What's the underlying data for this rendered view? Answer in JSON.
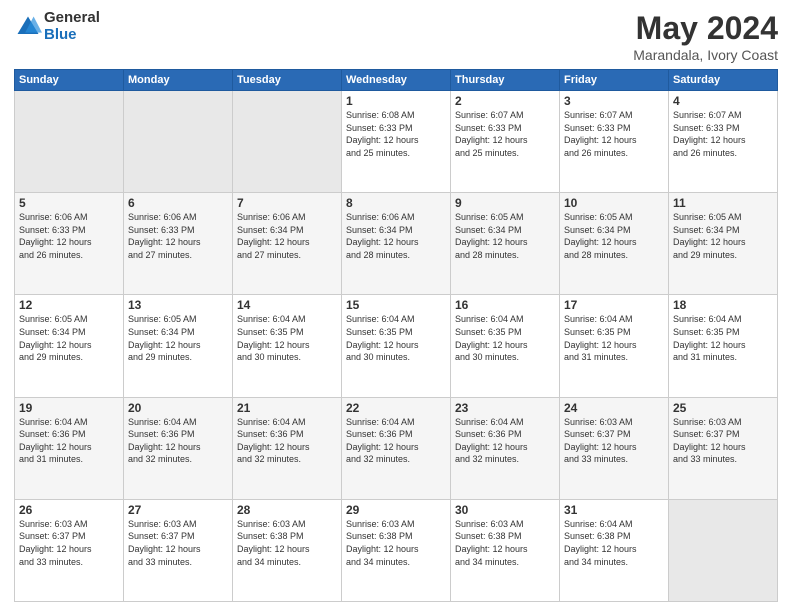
{
  "logo": {
    "general": "General",
    "blue": "Blue"
  },
  "header": {
    "title": "May 2024",
    "subtitle": "Marandala, Ivory Coast"
  },
  "days_of_week": [
    "Sunday",
    "Monday",
    "Tuesday",
    "Wednesday",
    "Thursday",
    "Friday",
    "Saturday"
  ],
  "weeks": [
    [
      {
        "day": "",
        "info": ""
      },
      {
        "day": "",
        "info": ""
      },
      {
        "day": "",
        "info": ""
      },
      {
        "day": "1",
        "info": "Sunrise: 6:08 AM\nSunset: 6:33 PM\nDaylight: 12 hours\nand 25 minutes."
      },
      {
        "day": "2",
        "info": "Sunrise: 6:07 AM\nSunset: 6:33 PM\nDaylight: 12 hours\nand 25 minutes."
      },
      {
        "day": "3",
        "info": "Sunrise: 6:07 AM\nSunset: 6:33 PM\nDaylight: 12 hours\nand 26 minutes."
      },
      {
        "day": "4",
        "info": "Sunrise: 6:07 AM\nSunset: 6:33 PM\nDaylight: 12 hours\nand 26 minutes."
      }
    ],
    [
      {
        "day": "5",
        "info": "Sunrise: 6:06 AM\nSunset: 6:33 PM\nDaylight: 12 hours\nand 26 minutes."
      },
      {
        "day": "6",
        "info": "Sunrise: 6:06 AM\nSunset: 6:33 PM\nDaylight: 12 hours\nand 27 minutes."
      },
      {
        "day": "7",
        "info": "Sunrise: 6:06 AM\nSunset: 6:34 PM\nDaylight: 12 hours\nand 27 minutes."
      },
      {
        "day": "8",
        "info": "Sunrise: 6:06 AM\nSunset: 6:34 PM\nDaylight: 12 hours\nand 28 minutes."
      },
      {
        "day": "9",
        "info": "Sunrise: 6:05 AM\nSunset: 6:34 PM\nDaylight: 12 hours\nand 28 minutes."
      },
      {
        "day": "10",
        "info": "Sunrise: 6:05 AM\nSunset: 6:34 PM\nDaylight: 12 hours\nand 28 minutes."
      },
      {
        "day": "11",
        "info": "Sunrise: 6:05 AM\nSunset: 6:34 PM\nDaylight: 12 hours\nand 29 minutes."
      }
    ],
    [
      {
        "day": "12",
        "info": "Sunrise: 6:05 AM\nSunset: 6:34 PM\nDaylight: 12 hours\nand 29 minutes."
      },
      {
        "day": "13",
        "info": "Sunrise: 6:05 AM\nSunset: 6:34 PM\nDaylight: 12 hours\nand 29 minutes."
      },
      {
        "day": "14",
        "info": "Sunrise: 6:04 AM\nSunset: 6:35 PM\nDaylight: 12 hours\nand 30 minutes."
      },
      {
        "day": "15",
        "info": "Sunrise: 6:04 AM\nSunset: 6:35 PM\nDaylight: 12 hours\nand 30 minutes."
      },
      {
        "day": "16",
        "info": "Sunrise: 6:04 AM\nSunset: 6:35 PM\nDaylight: 12 hours\nand 30 minutes."
      },
      {
        "day": "17",
        "info": "Sunrise: 6:04 AM\nSunset: 6:35 PM\nDaylight: 12 hours\nand 31 minutes."
      },
      {
        "day": "18",
        "info": "Sunrise: 6:04 AM\nSunset: 6:35 PM\nDaylight: 12 hours\nand 31 minutes."
      }
    ],
    [
      {
        "day": "19",
        "info": "Sunrise: 6:04 AM\nSunset: 6:36 PM\nDaylight: 12 hours\nand 31 minutes."
      },
      {
        "day": "20",
        "info": "Sunrise: 6:04 AM\nSunset: 6:36 PM\nDaylight: 12 hours\nand 32 minutes."
      },
      {
        "day": "21",
        "info": "Sunrise: 6:04 AM\nSunset: 6:36 PM\nDaylight: 12 hours\nand 32 minutes."
      },
      {
        "day": "22",
        "info": "Sunrise: 6:04 AM\nSunset: 6:36 PM\nDaylight: 12 hours\nand 32 minutes."
      },
      {
        "day": "23",
        "info": "Sunrise: 6:04 AM\nSunset: 6:36 PM\nDaylight: 12 hours\nand 32 minutes."
      },
      {
        "day": "24",
        "info": "Sunrise: 6:03 AM\nSunset: 6:37 PM\nDaylight: 12 hours\nand 33 minutes."
      },
      {
        "day": "25",
        "info": "Sunrise: 6:03 AM\nSunset: 6:37 PM\nDaylight: 12 hours\nand 33 minutes."
      }
    ],
    [
      {
        "day": "26",
        "info": "Sunrise: 6:03 AM\nSunset: 6:37 PM\nDaylight: 12 hours\nand 33 minutes."
      },
      {
        "day": "27",
        "info": "Sunrise: 6:03 AM\nSunset: 6:37 PM\nDaylight: 12 hours\nand 33 minutes."
      },
      {
        "day": "28",
        "info": "Sunrise: 6:03 AM\nSunset: 6:38 PM\nDaylight: 12 hours\nand 34 minutes."
      },
      {
        "day": "29",
        "info": "Sunrise: 6:03 AM\nSunset: 6:38 PM\nDaylight: 12 hours\nand 34 minutes."
      },
      {
        "day": "30",
        "info": "Sunrise: 6:03 AM\nSunset: 6:38 PM\nDaylight: 12 hours\nand 34 minutes."
      },
      {
        "day": "31",
        "info": "Sunrise: 6:04 AM\nSunset: 6:38 PM\nDaylight: 12 hours\nand 34 minutes."
      },
      {
        "day": "",
        "info": ""
      }
    ]
  ]
}
